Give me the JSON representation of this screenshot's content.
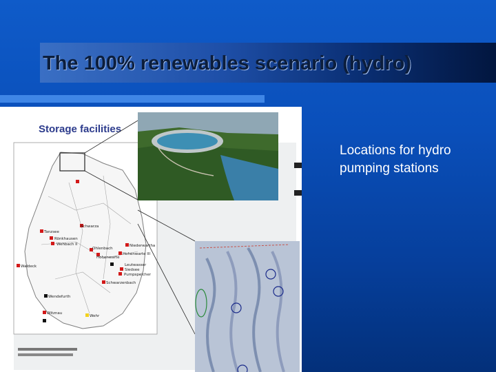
{
  "slide": {
    "title": "The 100% renewables scenario (hydro)",
    "subtitle": "Locations for hydro pumping stations"
  },
  "figure": {
    "header": "Storage facilities",
    "stations": [
      "Schwarza",
      "Tanzsee",
      "Rönkhausen",
      "Wehbach II",
      "Ohlenbach",
      "Niederwartha",
      "Waldeck",
      "Hohenwarte",
      "Hohenwarte III",
      "Leutwasser",
      "Siedsee",
      "Pumpspeicher",
      "Schwarzenbach",
      "Wendefurth",
      "Witznau",
      "Wehr"
    ]
  },
  "colors": {
    "background_top": "#0f5bc9",
    "background_bottom": "#03307a",
    "title_text": "#0c1e3c",
    "rule": "#3f86e6",
    "station_marker": "#d21919"
  }
}
